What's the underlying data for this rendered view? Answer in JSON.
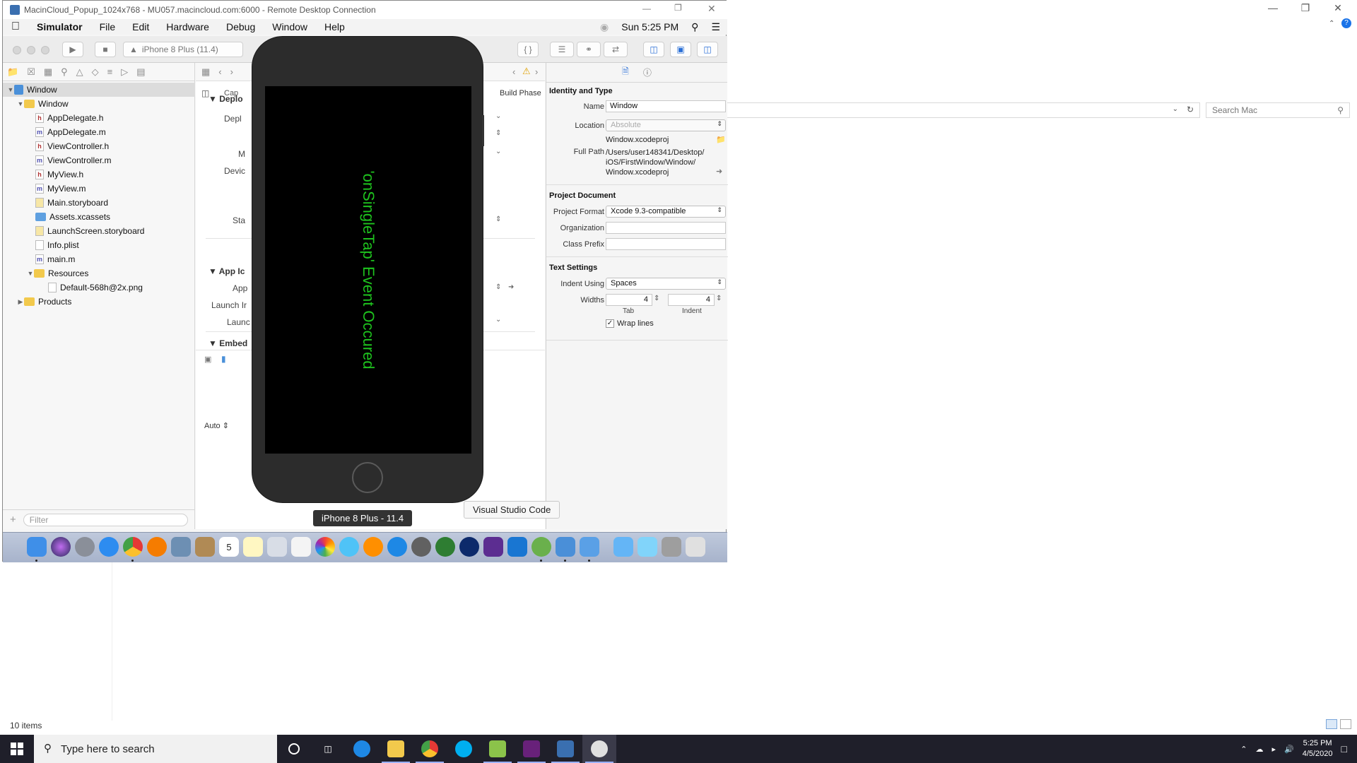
{
  "host": {
    "search_placeholder": "Search Mac",
    "status_items": "10 items"
  },
  "rdp": {
    "title": "MacinCloud_Popup_1024x768 - MU057.macincloud.com:6000 - Remote Desktop Connection"
  },
  "menubar": {
    "apple": "",
    "items": [
      "Simulator",
      "File",
      "Edit",
      "Hardware",
      "Debug",
      "Window",
      "Help"
    ],
    "clock": "Sun 5:25 PM"
  },
  "toolbar": {
    "scheme": "iPhone 8 Plus (11.4)"
  },
  "navigator": {
    "filter_placeholder": "Filter",
    "tree": [
      {
        "label": "Window",
        "kind": "project",
        "depth": 0,
        "expanded": true
      },
      {
        "label": "Window",
        "kind": "folder",
        "depth": 1,
        "expanded": true
      },
      {
        "label": "AppDelegate.h",
        "kind": "h",
        "depth": 2
      },
      {
        "label": "AppDelegate.m",
        "kind": "m",
        "depth": 2
      },
      {
        "label": "ViewController.h",
        "kind": "h",
        "depth": 2
      },
      {
        "label": "ViewController.m",
        "kind": "m",
        "depth": 2
      },
      {
        "label": "MyView.h",
        "kind": "h",
        "depth": 2
      },
      {
        "label": "MyView.m",
        "kind": "m",
        "depth": 2
      },
      {
        "label": "Main.storyboard",
        "kind": "sb",
        "depth": 2
      },
      {
        "label": "Assets.xcassets",
        "kind": "assets",
        "depth": 2
      },
      {
        "label": "LaunchScreen.storyboard",
        "kind": "sb",
        "depth": 2
      },
      {
        "label": "Info.plist",
        "kind": "plist",
        "depth": 2
      },
      {
        "label": "main.m",
        "kind": "m",
        "depth": 2
      },
      {
        "label": "Resources",
        "kind": "folder",
        "depth": 2,
        "expanded": true
      },
      {
        "label": "Default-568h@2x.png",
        "kind": "png",
        "depth": 3
      },
      {
        "label": "Products",
        "kind": "folder",
        "depth": 1,
        "expanded": false
      }
    ]
  },
  "editor": {
    "tab_partial": "Cap",
    "build_phases": "Build Phase",
    "sections": {
      "deploy": "Deplo",
      "deploy_target": "Depl",
      "device": "Devic",
      "m_label": "M",
      "status": "Sta",
      "app_icons": "App Ic",
      "app_label": "App",
      "launch_images": "Launch Ir",
      "launch_label": "Launc",
      "embedded": "Embed"
    },
    "bottom_auto": "Auto"
  },
  "inspector": {
    "identity_header": "Identity and Type",
    "name_label": "Name",
    "name_value": "Window",
    "location_label": "Location",
    "location_value": "Absolute",
    "file_name": "Window.xcodeproj",
    "full_path_label": "Full Path",
    "full_path_lines": [
      "/Users/user148341/Desktop/",
      "iOS/FirstWindow/Window/",
      "Window.xcodeproj"
    ],
    "project_doc_header": "Project Document",
    "project_format_label": "Project Format",
    "project_format_value": "Xcode 9.3-compatible",
    "organization_label": "Organization",
    "organization_value": "",
    "class_prefix_label": "Class Prefix",
    "class_prefix_value": "",
    "text_settings_header": "Text Settings",
    "indent_using_label": "Indent Using",
    "indent_using_value": "Spaces",
    "widths_label": "Widths",
    "tab_value": "4",
    "indent_value": "4",
    "tab_caption": "Tab",
    "indent_caption": "Indent",
    "wrap_lines_label": "Wrap lines",
    "wrap_lines_checked": "✓"
  },
  "simulator": {
    "message": "'onSingleTap' Event Occured",
    "message_color": "#1ec21e",
    "device_tooltip": "iPhone 8 Plus - 11.4"
  },
  "dock_tooltip": "Visual Studio Code",
  "dock": {
    "calendar_day": "5",
    "icons": [
      "finder-icon",
      "siri-icon",
      "launchpad-icon",
      "safari-icon",
      "chrome-icon",
      "firefox-icon",
      "preview-icon",
      "contacts-icon",
      "calendar-icon",
      "notes-icon",
      "photo-booth-icon",
      "reminders-icon",
      "photos-icon",
      "messages-icon",
      "books-icon",
      "app-store-icon",
      "system-preferences-icon",
      "evernote-icon",
      "dropbox-icon",
      "visual-studio-icon",
      "vscode-icon",
      "android-studio-icon",
      "xcode-icon",
      "xcode-icon-2",
      "folder-icon",
      "downloads-icon",
      "documents-icon",
      "trash-icon"
    ]
  },
  "taskbar": {
    "search_placeholder": "Type here to search",
    "time": "5:25 PM",
    "date": "4/5/2020"
  }
}
